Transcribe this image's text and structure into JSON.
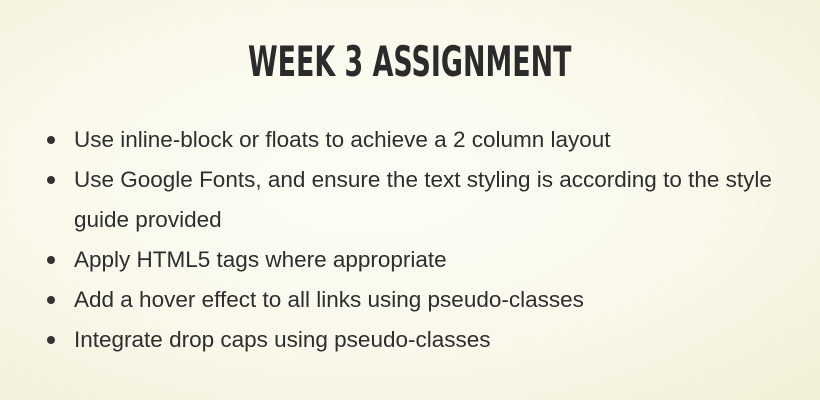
{
  "slide": {
    "title": "WEEK 3 ASSIGNMENT",
    "bullets": [
      "Use inline-block or floats to achieve a 2 column layout",
      "Use Google Fonts, and ensure the text styling is according to the style guide provided",
      "Apply HTML5 tags where appropriate",
      "Add a hover effect to all links using pseudo-classes",
      "Integrate drop caps using pseudo-classes"
    ]
  },
  "colors": {
    "background": "#f9f8ea",
    "text": "#2e2e2e",
    "title": "#2b2b2b"
  }
}
